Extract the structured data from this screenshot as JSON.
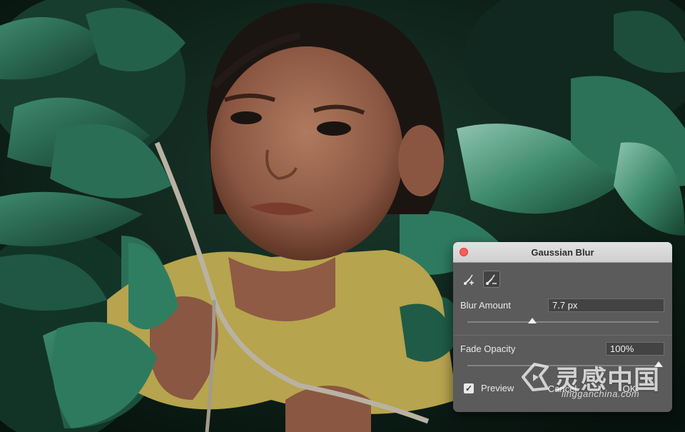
{
  "dialog": {
    "title": "Gaussian Blur",
    "tools": [
      {
        "icon": "brush-plus-icon"
      },
      {
        "icon": "brush-minus-icon",
        "active": true
      }
    ],
    "blur_amount": {
      "label": "Blur Amount",
      "value": "7.7 px",
      "slider_fraction": 0.34
    },
    "fade_opacity": {
      "label": "Fade Opacity",
      "value": "100%",
      "slider_fraction": 1.0
    },
    "preview": {
      "label": "Preview",
      "checked": true,
      "check_glyph": "✓"
    },
    "cancel_label": "Cancel",
    "ok_label": "OK"
  },
  "watermark": {
    "brand": "灵感中国",
    "url": "lingganchina.com"
  },
  "colors": {
    "dialog_bg": "#5b5b5b",
    "titlebar": "#d8d8d8",
    "close_button": "#fc5c57",
    "leaf_green": "#1e5c46",
    "shirt_yellow": "#b9a64e"
  }
}
